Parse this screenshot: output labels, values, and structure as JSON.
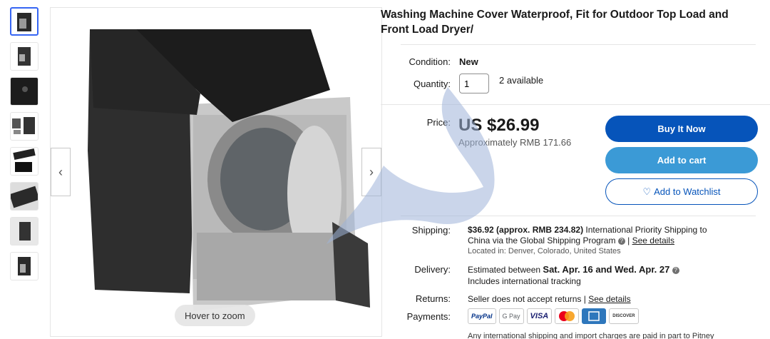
{
  "product": {
    "title": "Washing Machine Cover Waterproof, Fit for Outdoor Top Load and Front Load Dryer/"
  },
  "viewer": {
    "zoom_hint": "Hover to zoom",
    "prev_icon": "chevron-left-icon",
    "next_icon": "chevron-right-icon"
  },
  "thumbnails": [
    {
      "name": "thumb-1"
    },
    {
      "name": "thumb-2"
    },
    {
      "name": "thumb-3"
    },
    {
      "name": "thumb-4"
    },
    {
      "name": "thumb-5"
    },
    {
      "name": "thumb-6"
    },
    {
      "name": "thumb-7"
    },
    {
      "name": "thumb-8"
    }
  ],
  "details": {
    "condition_label": "Condition:",
    "condition_value": "New",
    "quantity_label": "Quantity:",
    "quantity_value": "1",
    "available": "2 available"
  },
  "pricing": {
    "price_label": "Price:",
    "price": "US $26.99",
    "approx": "Approximately RMB 171.66"
  },
  "actions": {
    "buy": "Buy It Now",
    "cart": "Add to cart",
    "watch": "Add to Watchlist",
    "watch_icon": "heart-outline-icon"
  },
  "shipping": {
    "label": "Shipping:",
    "cost": "$36.92 (approx. RMB 234.82)",
    "desc1": "International Priority Shipping to",
    "desc2": "China  via the Global Shipping Program",
    "see_details": "See details",
    "location": "Located in: Denver, Colorado, United States"
  },
  "delivery": {
    "label": "Delivery:",
    "prefix": "Estimated between",
    "dates": "Sat. Apr. 16 and Wed. Apr. 27",
    "tracking": "Includes international tracking"
  },
  "returns": {
    "label": "Returns:",
    "text": "Seller does not accept returns |",
    "see_details": "See details"
  },
  "payments": {
    "label": "Payments:",
    "methods": [
      "PayPal",
      "G Pay",
      "VISA",
      "Mastercard",
      "Amex",
      "DISCOVER"
    ]
  },
  "footnote": "Any international shipping and import charges are paid in part to Pitney",
  "colors": {
    "buy": "#0654ba",
    "cart": "#3b9ad6",
    "active_thumb": "#3665f3"
  }
}
